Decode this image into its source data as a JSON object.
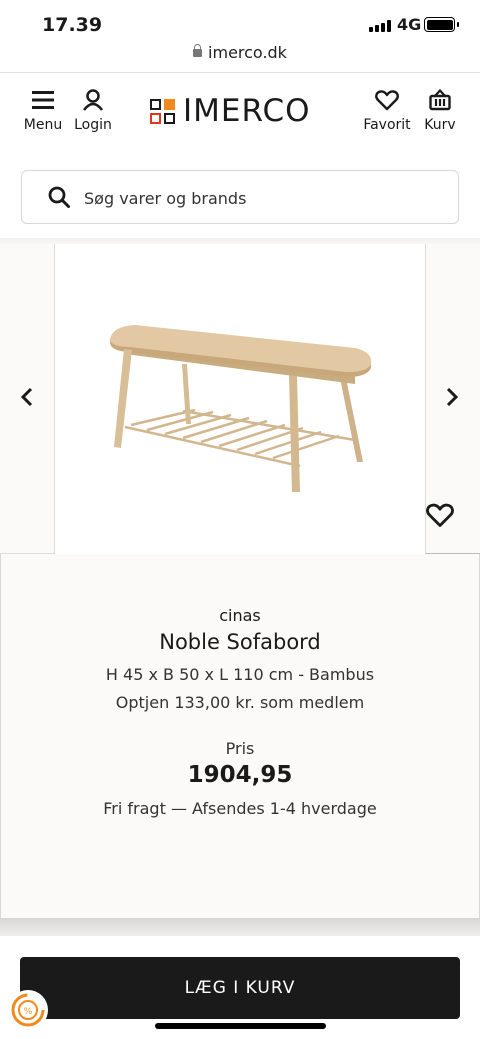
{
  "status_bar": {
    "time": "17.39",
    "network": "4G"
  },
  "browser": {
    "url": "imerco.dk"
  },
  "header": {
    "menu_label": "Menu",
    "login_label": "Login",
    "logo_text": "IMERCO",
    "favorite_label": "Favorit",
    "cart_label": "Kurv"
  },
  "search": {
    "placeholder": "Søg varer og brands"
  },
  "product": {
    "brand": "cinas",
    "title": "Noble Sofabord",
    "dimensions": "H 45 x B 50 x L 110 cm - Bambus",
    "member_points": "Optjen 133,00 kr. som medlem",
    "price_label": "Pris",
    "price": "1904,95",
    "shipping": "Fri fragt — Afsendes 1-4 hverdage",
    "image_icon": "coffee-table-image"
  },
  "actions": {
    "add_to_cart": "LÆG I KURV"
  },
  "colors": {
    "accent_orange": "#f08a1c",
    "accent_red": "#e4351f",
    "button_dark": "#1a1a1a"
  }
}
